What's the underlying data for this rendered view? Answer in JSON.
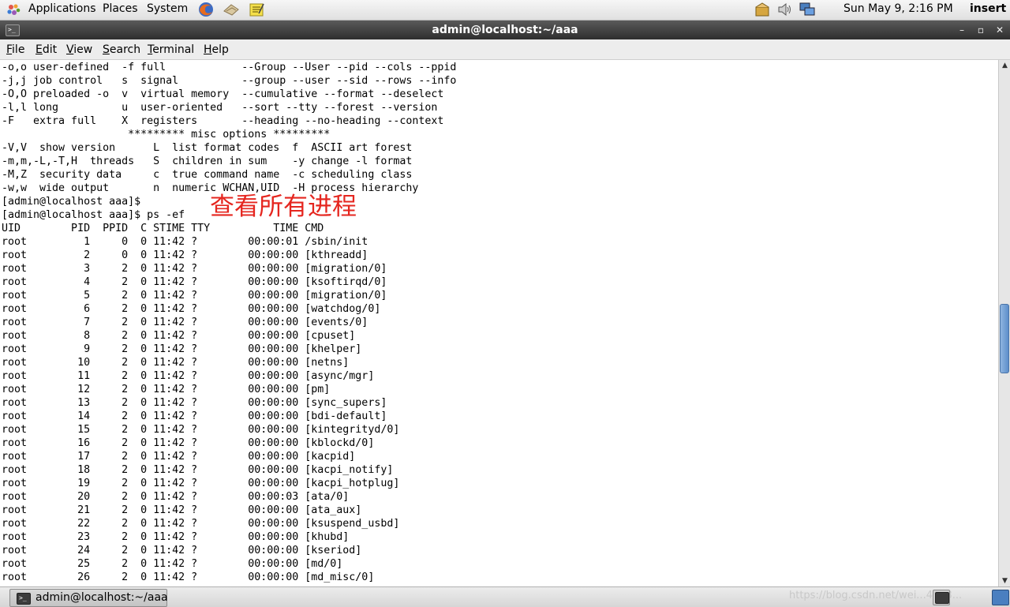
{
  "top_panel": {
    "menus": [
      "Applications",
      "Places",
      "System"
    ],
    "clock": "Sun May  9,  2:16 PM",
    "keyboard_mode": "insert"
  },
  "window": {
    "title": "admin@localhost:~/aaa"
  },
  "menubar": {
    "items": [
      {
        "label": "File",
        "accel": "F",
        "rest": "ile"
      },
      {
        "label": "Edit",
        "accel": "E",
        "rest": "dit"
      },
      {
        "label": "View",
        "accel": "V",
        "rest": "iew"
      },
      {
        "label": "Search",
        "accel": "S",
        "rest": "earch"
      },
      {
        "label": "Terminal",
        "accel": "T",
        "rest": "erminal"
      },
      {
        "label": "Help",
        "accel": "H",
        "rest": "elp"
      }
    ]
  },
  "terminal": {
    "lines": [
      "-o,o user-defined  -f full            --Group --User --pid --cols --ppid",
      "-j,j job control   s  signal          --group --user --sid --rows --info",
      "-O,O preloaded -o  v  virtual memory  --cumulative --format --deselect",
      "-l,l long          u  user-oriented   --sort --tty --forest --version",
      "-F   extra full    X  registers       --heading --no-heading --context",
      "                    ********* misc options *********",
      "-V,V  show version      L  list format codes  f  ASCII art forest",
      "-m,m,-L,-T,H  threads   S  children in sum    -y change -l format",
      "-M,Z  security data     c  true command name  -c scheduling class",
      "-w,w  wide output       n  numeric WCHAN,UID  -H process hierarchy",
      "[admin@localhost aaa]$",
      "[admin@localhost aaa]$ ps -ef",
      "UID        PID  PPID  C STIME TTY          TIME CMD",
      "root         1     0  0 11:42 ?        00:00:01 /sbin/init",
      "root         2     0  0 11:42 ?        00:00:00 [kthreadd]",
      "root         3     2  0 11:42 ?        00:00:00 [migration/0]",
      "root         4     2  0 11:42 ?        00:00:00 [ksoftirqd/0]",
      "root         5     2  0 11:42 ?        00:00:00 [migration/0]",
      "root         6     2  0 11:42 ?        00:00:00 [watchdog/0]",
      "root         7     2  0 11:42 ?        00:00:00 [events/0]",
      "root         8     2  0 11:42 ?        00:00:00 [cpuset]",
      "root         9     2  0 11:42 ?        00:00:00 [khelper]",
      "root        10     2  0 11:42 ?        00:00:00 [netns]",
      "root        11     2  0 11:42 ?        00:00:00 [async/mgr]",
      "root        12     2  0 11:42 ?        00:00:00 [pm]",
      "root        13     2  0 11:42 ?        00:00:00 [sync_supers]",
      "root        14     2  0 11:42 ?        00:00:00 [bdi-default]",
      "root        15     2  0 11:42 ?        00:00:00 [kintegrityd/0]",
      "root        16     2  0 11:42 ?        00:00:00 [kblockd/0]",
      "root        17     2  0 11:42 ?        00:00:00 [kacpid]",
      "root        18     2  0 11:42 ?        00:00:00 [kacpi_notify]",
      "root        19     2  0 11:42 ?        00:00:00 [kacpi_hotplug]",
      "root        20     2  0 11:42 ?        00:00:03 [ata/0]",
      "root        21     2  0 11:42 ?        00:00:00 [ata_aux]",
      "root        22     2  0 11:42 ?        00:00:00 [ksuspend_usbd]",
      "root        23     2  0 11:42 ?        00:00:00 [khubd]",
      "root        24     2  0 11:42 ?        00:00:00 [kseriod]",
      "root        25     2  0 11:42 ?        00:00:00 [md/0]",
      "root        26     2  0 11:42 ?        00:00:00 [md_misc/0]"
    ],
    "annotation": "查看所有进程",
    "annotation_color": "#e5261f"
  },
  "taskbar": {
    "window_button": "admin@localhost:~/aaa",
    "watermark": "https://blog.csdn.net/wei...4903..."
  }
}
